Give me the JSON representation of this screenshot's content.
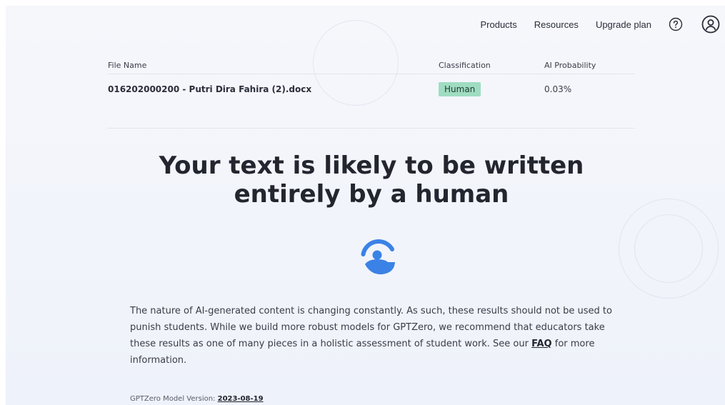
{
  "nav": {
    "products": "Products",
    "resources": "Resources",
    "upgrade": "Upgrade plan",
    "help_icon": "question-circle-icon",
    "profile_icon": "user-circle-icon"
  },
  "table": {
    "headers": [
      "File Name",
      "Classification",
      "AI Probability"
    ],
    "rows": [
      {
        "file": "016202000200 - Putri Dira Fahira (2).docx",
        "classification": "Human",
        "probability": "0.03%"
      }
    ]
  },
  "result": {
    "headline_line1": "Your text is likely to be written",
    "headline_line2": "entirely by a human"
  },
  "logo": {
    "icon": "gptzero-logo-icon",
    "color": "#3b82e6"
  },
  "description": {
    "text_before": "The nature of AI-generated content is changing constantly. As such, these results should not be used to punish students. While we build more robust models for GPTZero, we recommend that educators take these results as one of many pieces in a holistic assessment of student work. See our ",
    "faq_link": "FAQ",
    "text_after": " for more information."
  },
  "version": {
    "label": "GPTZero Model Version: ",
    "value": "2023-08-19"
  },
  "colors": {
    "human_badge": "#9fdcc1",
    "accent": "#3b82e6"
  }
}
